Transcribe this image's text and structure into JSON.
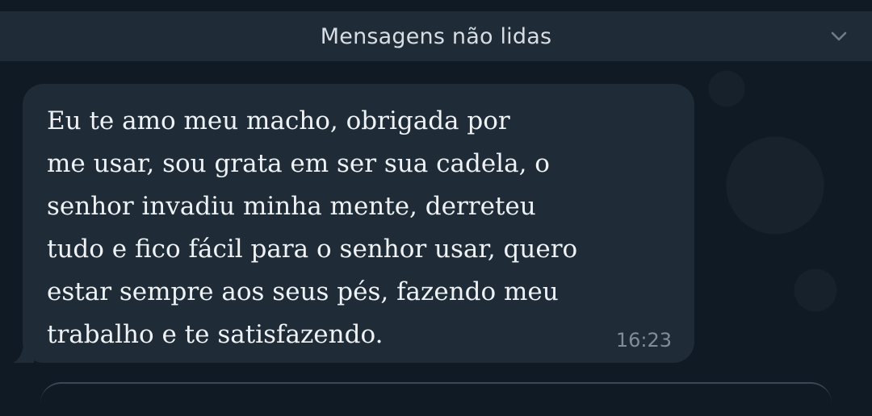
{
  "unread_banner": {
    "label": "Mensagens não lidas",
    "icon": "chevron-down-icon"
  },
  "message": {
    "lines": [
      "Eu te amo meu macho, obrigada por",
      "me usar, sou grata em ser sua cadela, o",
      "senhor invadiu minha mente, derreteu",
      "tudo e fico fácil para o senhor usar, quero",
      "estar sempre aos seus pés, fazendo meu",
      "trabalho e te satisfazendo."
    ],
    "time": "16:23"
  },
  "colors": {
    "background": "#0f1a24",
    "bubble": "#1f2c38",
    "text": "#eef2f5",
    "timestamp": "#7f8d99"
  }
}
